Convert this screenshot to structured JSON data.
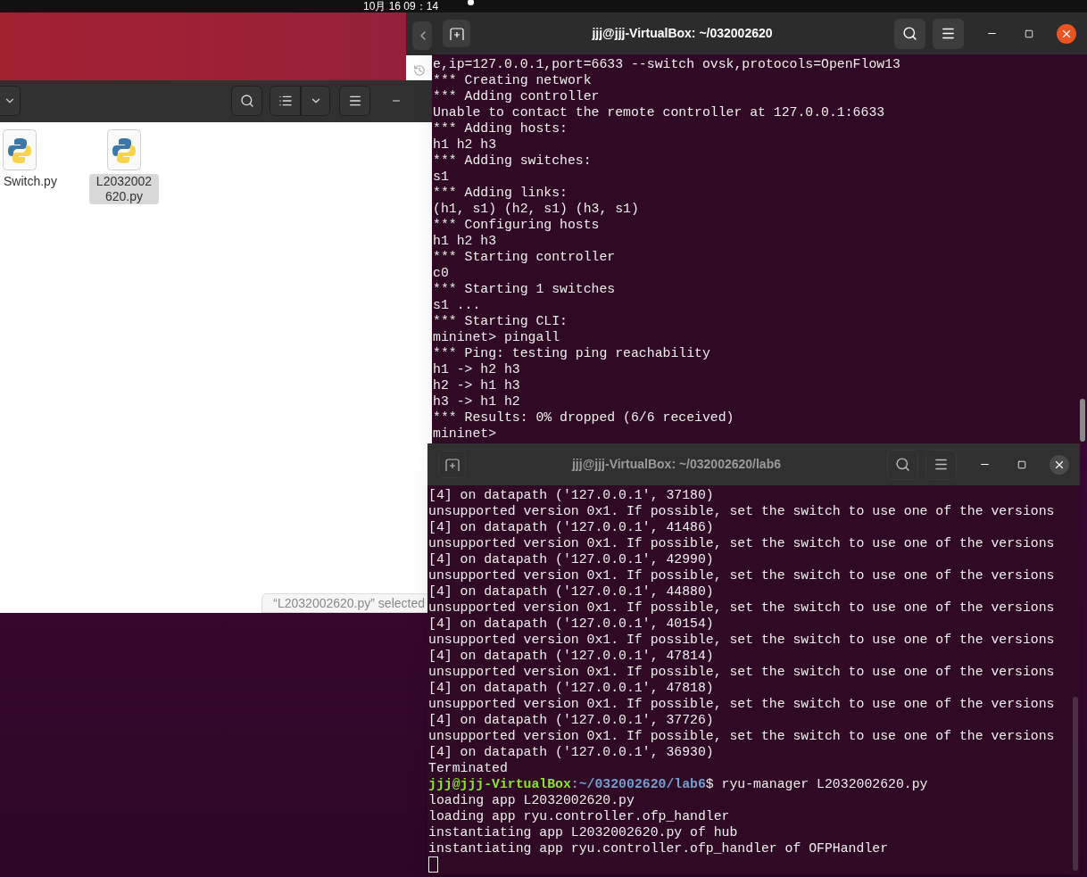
{
  "top_bar": {
    "clock": "10月 16 09：14",
    "notification": true
  },
  "file_manager": {
    "files": [
      {
        "name": "Switch.py",
        "selected": false
      },
      {
        "name": "L2032002620.py",
        "selected": true
      }
    ],
    "status": "“L2032002620.py” selected"
  },
  "terminals": [
    {
      "title": "jjj@jjj-VirtualBox: ~/032002620",
      "active": true,
      "cursor": false,
      "lines": [
        {
          "kind": "output",
          "text": "e,ip=127.0.0.1,port=6633 --switch ovsk,protocols=OpenFlow13"
        },
        {
          "kind": "output",
          "text": "*** Creating network"
        },
        {
          "kind": "output",
          "text": "*** Adding controller"
        },
        {
          "kind": "output",
          "text": "Unable to contact the remote controller at 127.0.0.1:6633"
        },
        {
          "kind": "output",
          "text": "*** Adding hosts:"
        },
        {
          "kind": "output",
          "text": "h1 h2 h3"
        },
        {
          "kind": "output",
          "text": "*** Adding switches:"
        },
        {
          "kind": "output",
          "text": "s1"
        },
        {
          "kind": "output",
          "text": "*** Adding links:"
        },
        {
          "kind": "output",
          "text": "(h1, s1) (h2, s1) (h3, s1)"
        },
        {
          "kind": "output",
          "text": "*** Configuring hosts"
        },
        {
          "kind": "output",
          "text": "h1 h2 h3"
        },
        {
          "kind": "output",
          "text": "*** Starting controller"
        },
        {
          "kind": "output",
          "text": "c0"
        },
        {
          "kind": "output",
          "text": "*** Starting 1 switches"
        },
        {
          "kind": "output",
          "text": "s1 ..."
        },
        {
          "kind": "output",
          "text": "*** Starting CLI:"
        },
        {
          "kind": "output",
          "text": "mininet> pingall"
        },
        {
          "kind": "output",
          "text": "*** Ping: testing ping reachability"
        },
        {
          "kind": "output",
          "text": "h1 -> h2 h3"
        },
        {
          "kind": "output",
          "text": "h2 -> h1 h3"
        },
        {
          "kind": "output",
          "text": "h3 -> h1 h2"
        },
        {
          "kind": "output",
          "text": "*** Results: 0% dropped (6/6 received)"
        },
        {
          "kind": "output",
          "text": "mininet>"
        }
      ]
    },
    {
      "title": "jjj@jjj-VirtualBox: ~/032002620/lab6",
      "active": false,
      "cursor": true,
      "lines": [
        {
          "kind": "output",
          "text": "[4] on datapath ('127.0.0.1', 37180)"
        },
        {
          "kind": "output",
          "text": "unsupported version 0x1. If possible, set the switch to use one of the versions"
        },
        {
          "kind": "output",
          "text": "[4] on datapath ('127.0.0.1', 41486)"
        },
        {
          "kind": "output",
          "text": "unsupported version 0x1. If possible, set the switch to use one of the versions"
        },
        {
          "kind": "output",
          "text": "[4] on datapath ('127.0.0.1', 42990)"
        },
        {
          "kind": "output",
          "text": "unsupported version 0x1. If possible, set the switch to use one of the versions"
        },
        {
          "kind": "output",
          "text": "[4] on datapath ('127.0.0.1', 44880)"
        },
        {
          "kind": "output",
          "text": "unsupported version 0x1. If possible, set the switch to use one of the versions"
        },
        {
          "kind": "output",
          "text": "[4] on datapath ('127.0.0.1', 40154)"
        },
        {
          "kind": "output",
          "text": "unsupported version 0x1. If possible, set the switch to use one of the versions"
        },
        {
          "kind": "output",
          "text": "[4] on datapath ('127.0.0.1', 47814)"
        },
        {
          "kind": "output",
          "text": "unsupported version 0x1. If possible, set the switch to use one of the versions"
        },
        {
          "kind": "output",
          "text": "[4] on datapath ('127.0.0.1', 47818)"
        },
        {
          "kind": "output",
          "text": "unsupported version 0x1. If possible, set the switch to use one of the versions"
        },
        {
          "kind": "output",
          "text": "[4] on datapath ('127.0.0.1', 37726)"
        },
        {
          "kind": "output",
          "text": "unsupported version 0x1. If possible, set the switch to use one of the versions"
        },
        {
          "kind": "output",
          "text": "[4] on datapath ('127.0.0.1', 36930)"
        },
        {
          "kind": "output",
          "text": "Terminated"
        },
        {
          "kind": "prompt",
          "user": "jjj@jjj-VirtualBox",
          "path": ":~/032002620/lab6",
          "command": "$ ryu-manager L2032002620.py"
        },
        {
          "kind": "output",
          "text": "loading app L2032002620.py"
        },
        {
          "kind": "output",
          "text": "loading app ryu.controller.ofp_handler"
        },
        {
          "kind": "output",
          "text": "instantiating app L2032002620.py of hub"
        },
        {
          "kind": "output",
          "text": "instantiating app ryu.controller.ofp_handler of OFPHandler"
        }
      ]
    }
  ]
}
